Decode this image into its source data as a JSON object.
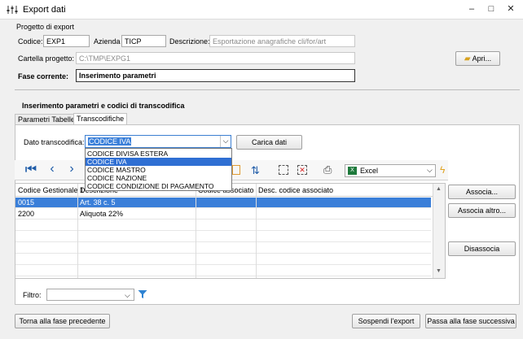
{
  "window": {
    "title": "Export dati",
    "minimize": "–",
    "maximize": "□",
    "close": "✕"
  },
  "progetto": {
    "group_title": "Progetto di export",
    "codice_label": "Codice:",
    "codice_value": "EXP1",
    "azienda_label": "Azienda",
    "azienda_value": "TICP",
    "descrizione_label": "Descrizione:",
    "descrizione_value": "Esportazione anagrafiche cli/for/art",
    "cartella_label": "Cartella progetto:",
    "cartella_value": "C:\\TMP\\EXPG1",
    "apri_label": "Apri...",
    "fase_label": "Fase corrente:",
    "fase_value": "Inserimento parametri"
  },
  "section_title": "Inserimento parametri e codici di transcodifica",
  "tabs": [
    {
      "label": "Parametri Tabelle"
    },
    {
      "label": "Transcodifiche"
    }
  ],
  "transcodifica": {
    "label": "Dato transcodifica:",
    "selected": "CODICE IVA",
    "carica_label": "Carica dati",
    "options": [
      "CODICE DIVISA ESTERA",
      "CODICE IVA",
      "CODICE MASTRO",
      "CODICE NAZIONE",
      "CODICE CONDIZIONE DI PAGAMENTO"
    ]
  },
  "toolbar": {
    "export_format": "Excel"
  },
  "grid": {
    "columns": [
      "Codice Gestionale 1",
      "Descrizione",
      "Codice associato",
      "Desc. codice associato"
    ],
    "rows": [
      {
        "codice": "0015",
        "descrizione": "Art. 38 c. 5",
        "associato": "",
        "desc_associato": ""
      },
      {
        "codice": "2200",
        "descrizione": "Aliquota 22%",
        "associato": "",
        "desc_associato": ""
      }
    ]
  },
  "side_buttons": {
    "associa": "Associa...",
    "associa_altro": "Associa altro...",
    "disassocia": "Disassocia"
  },
  "filtro_label": "Filtro:",
  "footer": {
    "back": "Torna alla fase precedente",
    "suspend": "Sospendi l'export",
    "next": "Passa alla fase successiva"
  }
}
